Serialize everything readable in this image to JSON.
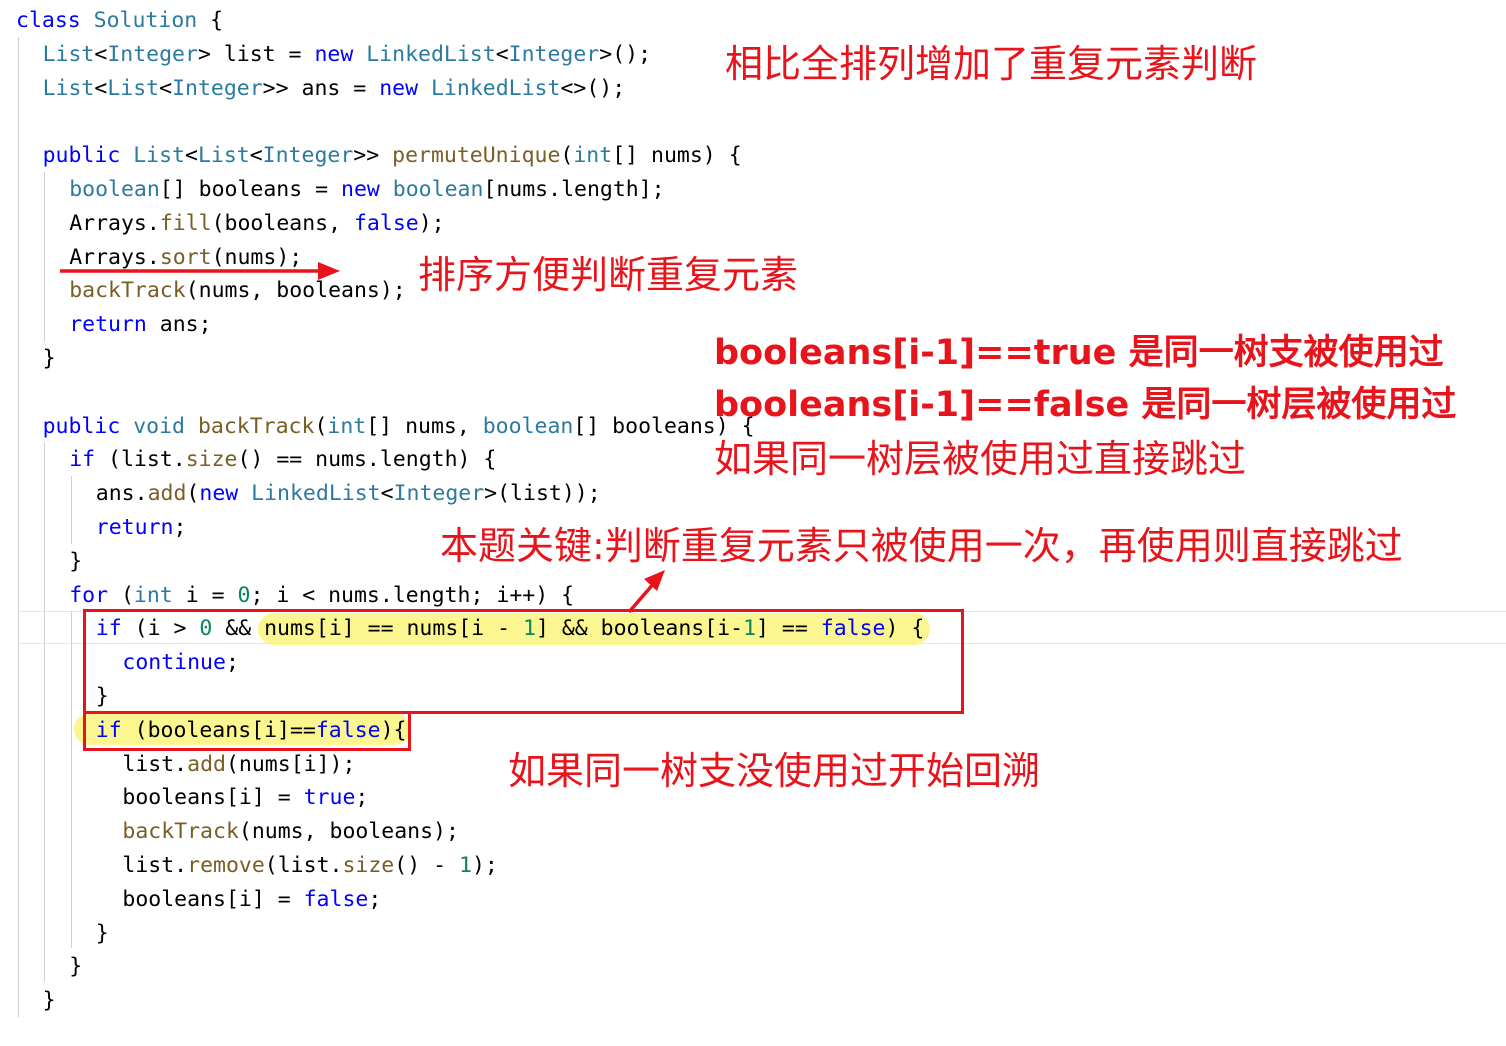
{
  "code_lines": [
    {
      "indent": 0,
      "tokens": [
        {
          "t": "class ",
          "c": "kw"
        },
        {
          "t": "Solution",
          "c": "ty"
        },
        {
          "t": " {",
          "c": "plain"
        }
      ]
    },
    {
      "indent": 1,
      "tokens": [
        {
          "t": "List",
          "c": "ty"
        },
        {
          "t": "<",
          "c": "plain"
        },
        {
          "t": "Integer",
          "c": "ty"
        },
        {
          "t": "> ",
          "c": "plain"
        },
        {
          "t": "list",
          "c": "plain"
        },
        {
          "t": " = ",
          "c": "plain"
        },
        {
          "t": "new ",
          "c": "kw"
        },
        {
          "t": "LinkedList",
          "c": "ty"
        },
        {
          "t": "<",
          "c": "plain"
        },
        {
          "t": "Integer",
          "c": "ty"
        },
        {
          "t": ">();",
          "c": "plain"
        }
      ]
    },
    {
      "indent": 1,
      "tokens": [
        {
          "t": "List",
          "c": "ty"
        },
        {
          "t": "<",
          "c": "plain"
        },
        {
          "t": "List",
          "c": "ty"
        },
        {
          "t": "<",
          "c": "plain"
        },
        {
          "t": "Integer",
          "c": "ty"
        },
        {
          "t": ">> ",
          "c": "plain"
        },
        {
          "t": "ans",
          "c": "plain"
        },
        {
          "t": " = ",
          "c": "plain"
        },
        {
          "t": "new ",
          "c": "kw"
        },
        {
          "t": "LinkedList",
          "c": "ty"
        },
        {
          "t": "<>();",
          "c": "plain"
        }
      ]
    },
    {
      "indent": 0,
      "tokens": []
    },
    {
      "indent": 1,
      "tokens": [
        {
          "t": "public ",
          "c": "kw"
        },
        {
          "t": "List",
          "c": "ty"
        },
        {
          "t": "<",
          "c": "plain"
        },
        {
          "t": "List",
          "c": "ty"
        },
        {
          "t": "<",
          "c": "plain"
        },
        {
          "t": "Integer",
          "c": "ty"
        },
        {
          "t": ">> ",
          "c": "plain"
        },
        {
          "t": "permuteUnique",
          "c": "fn"
        },
        {
          "t": "(",
          "c": "plain"
        },
        {
          "t": "int",
          "c": "ty"
        },
        {
          "t": "[] nums) {",
          "c": "plain"
        }
      ]
    },
    {
      "indent": 2,
      "tokens": [
        {
          "t": "boolean",
          "c": "ty"
        },
        {
          "t": "[] booleans = ",
          "c": "plain"
        },
        {
          "t": "new ",
          "c": "kw"
        },
        {
          "t": "boolean",
          "c": "ty"
        },
        {
          "t": "[nums.length];",
          "c": "plain"
        }
      ]
    },
    {
      "indent": 2,
      "tokens": [
        {
          "t": "Arrays",
          "c": "plain"
        },
        {
          "t": ".",
          "c": "plain"
        },
        {
          "t": "fill",
          "c": "fn"
        },
        {
          "t": "(booleans, ",
          "c": "plain"
        },
        {
          "t": "false",
          "c": "kw"
        },
        {
          "t": ");",
          "c": "plain"
        }
      ]
    },
    {
      "indent": 2,
      "tokens": [
        {
          "t": "Arrays",
          "c": "plain"
        },
        {
          "t": ".",
          "c": "plain"
        },
        {
          "t": "sort",
          "c": "fn"
        },
        {
          "t": "(nums);",
          "c": "plain"
        }
      ]
    },
    {
      "indent": 2,
      "tokens": [
        {
          "t": "backTrack",
          "c": "fn"
        },
        {
          "t": "(nums, booleans);",
          "c": "plain"
        }
      ]
    },
    {
      "indent": 2,
      "tokens": [
        {
          "t": "return ",
          "c": "kw"
        },
        {
          "t": "ans;",
          "c": "plain"
        }
      ]
    },
    {
      "indent": 1,
      "tokens": [
        {
          "t": "}",
          "c": "plain"
        }
      ]
    },
    {
      "indent": 0,
      "tokens": []
    },
    {
      "indent": 1,
      "tokens": [
        {
          "t": "public ",
          "c": "kw"
        },
        {
          "t": "void ",
          "c": "ty"
        },
        {
          "t": "backTrack",
          "c": "fn"
        },
        {
          "t": "(",
          "c": "plain"
        },
        {
          "t": "int",
          "c": "ty"
        },
        {
          "t": "[] nums, ",
          "c": "plain"
        },
        {
          "t": "boolean",
          "c": "ty"
        },
        {
          "t": "[] booleans) {",
          "c": "plain"
        }
      ]
    },
    {
      "indent": 2,
      "tokens": [
        {
          "t": "if ",
          "c": "kw"
        },
        {
          "t": "(list.",
          "c": "plain"
        },
        {
          "t": "size",
          "c": "fn"
        },
        {
          "t": "() == nums.length) {",
          "c": "plain"
        }
      ]
    },
    {
      "indent": 3,
      "tokens": [
        {
          "t": "ans.",
          "c": "plain"
        },
        {
          "t": "add",
          "c": "fn"
        },
        {
          "t": "(",
          "c": "plain"
        },
        {
          "t": "new ",
          "c": "kw"
        },
        {
          "t": "LinkedList",
          "c": "ty"
        },
        {
          "t": "<",
          "c": "plain"
        },
        {
          "t": "Integer",
          "c": "ty"
        },
        {
          "t": ">(list));",
          "c": "plain"
        }
      ]
    },
    {
      "indent": 3,
      "tokens": [
        {
          "t": "return",
          "c": "kw"
        },
        {
          "t": ";",
          "c": "plain"
        }
      ]
    },
    {
      "indent": 2,
      "tokens": [
        {
          "t": "}",
          "c": "plain"
        }
      ]
    },
    {
      "indent": 2,
      "tokens": [
        {
          "t": "for ",
          "c": "kw"
        },
        {
          "t": "(",
          "c": "plain"
        },
        {
          "t": "int ",
          "c": "ty"
        },
        {
          "t": "i = ",
          "c": "plain"
        },
        {
          "t": "0",
          "c": "num"
        },
        {
          "t": "; i < nums.length; i++) {",
          "c": "plain"
        }
      ]
    },
    {
      "indent": 3,
      "tokens": [
        {
          "t": "if ",
          "c": "kw"
        },
        {
          "t": "(i > ",
          "c": "plain"
        },
        {
          "t": "0",
          "c": "num"
        },
        {
          "t": " && nums[i] == nums[i - ",
          "c": "plain"
        },
        {
          "t": "1",
          "c": "num"
        },
        {
          "t": "] && booleans[i-",
          "c": "plain"
        },
        {
          "t": "1",
          "c": "num"
        },
        {
          "t": "] == ",
          "c": "plain"
        },
        {
          "t": "false",
          "c": "kw"
        },
        {
          "t": ") {",
          "c": "plain"
        }
      ]
    },
    {
      "indent": 4,
      "tokens": [
        {
          "t": "continue",
          "c": "kw"
        },
        {
          "t": ";",
          "c": "plain"
        }
      ]
    },
    {
      "indent": 3,
      "tokens": [
        {
          "t": "}",
          "c": "plain"
        }
      ]
    },
    {
      "indent": 3,
      "tokens": [
        {
          "t": "if ",
          "c": "kw"
        },
        {
          "t": "(booleans[i]==",
          "c": "plain"
        },
        {
          "t": "false",
          "c": "kw"
        },
        {
          "t": "){",
          "c": "plain"
        }
      ]
    },
    {
      "indent": 4,
      "tokens": [
        {
          "t": "list.",
          "c": "plain"
        },
        {
          "t": "add",
          "c": "fn"
        },
        {
          "t": "(nums[i]);",
          "c": "plain"
        }
      ]
    },
    {
      "indent": 4,
      "tokens": [
        {
          "t": "booleans[i] = ",
          "c": "plain"
        },
        {
          "t": "true",
          "c": "kw"
        },
        {
          "t": ";",
          "c": "plain"
        }
      ]
    },
    {
      "indent": 4,
      "tokens": [
        {
          "t": "backTrack",
          "c": "fn"
        },
        {
          "t": "(nums, booleans);",
          "c": "plain"
        }
      ]
    },
    {
      "indent": 4,
      "tokens": [
        {
          "t": "list.",
          "c": "plain"
        },
        {
          "t": "remove",
          "c": "fn"
        },
        {
          "t": "(list.",
          "c": "plain"
        },
        {
          "t": "size",
          "c": "fn"
        },
        {
          "t": "() - ",
          "c": "plain"
        },
        {
          "t": "1",
          "c": "num"
        },
        {
          "t": ");",
          "c": "plain"
        }
      ]
    },
    {
      "indent": 4,
      "tokens": [
        {
          "t": "booleans[i] = ",
          "c": "plain"
        },
        {
          "t": "false",
          "c": "kw"
        },
        {
          "t": ";",
          "c": "plain"
        }
      ]
    },
    {
      "indent": 3,
      "tokens": [
        {
          "t": "}",
          "c": "plain"
        }
      ]
    },
    {
      "indent": 2,
      "tokens": [
        {
          "t": "}",
          "c": "plain"
        }
      ]
    },
    {
      "indent": 1,
      "tokens": [
        {
          "t": "}",
          "c": "plain"
        }
      ]
    }
  ],
  "annotations": {
    "title_note": "相比全排列增加了重复元素判断",
    "sort_note": "排序方便判断重复元素",
    "branch_note": "booleans[i-1]==true 是同一树支被使用过",
    "level_note": "booleans[i-1]==false 是同一树层被使用过",
    "skip_note": "如果同一树层被使用过直接跳过",
    "key_note": "本题关键:判断重复元素只被使用一次，再使用则直接跳过",
    "backtrack_note": "如果同一树支没使用过开始回溯"
  },
  "colors": {
    "keyword": "#0000ff",
    "type": "#2b7a9f",
    "function": "#795e26",
    "number": "#098658",
    "annotation": "#e8141b",
    "highlight": "#fbf584"
  }
}
